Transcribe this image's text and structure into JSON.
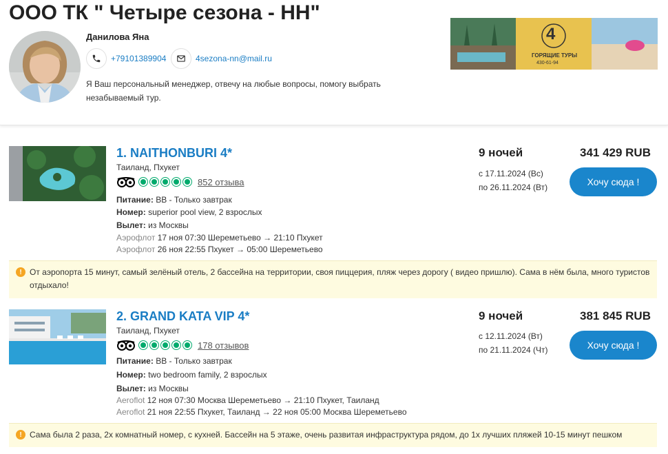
{
  "header": {
    "company": "ООО ТК \" Четыре сезона - НН\"",
    "manager_name": "Данилова Яна",
    "phone": "+79101389904",
    "email": "4sezona-nn@mail.ru",
    "description": "Я Ваш персональный менеджер, отвечу на любые вопросы, помогу выбрать незабываемый тур.",
    "banner": {
      "logo_digit": "4",
      "tagline": "ГОРЯЩИЕ ТУРЫ",
      "phone": "430-61-94"
    }
  },
  "tours": [
    {
      "title": "1. NAITHONBURI 4*",
      "location": "Таиланд, Пхукет",
      "rating_circles": 5,
      "reviews": "852 отзыва",
      "meal_label": "Питание:",
      "meal": "BB - Только завтрак",
      "room_label": "Номер:",
      "room": "superior pool view, 2 взрослых",
      "departure_label": "Вылет:",
      "departure": "из Москвы",
      "flights": [
        {
          "airline": "Аэрофлот",
          "route": "17 ноя 07:30 Шереметьево → 21:10 Пхукет"
        },
        {
          "airline": "Аэрофлот",
          "route": "26 ноя 22:55 Пхукет → 05:00 Шереметьево"
        }
      ],
      "nights": "9 ночей",
      "date_from": "с 17.11.2024 (Вс)",
      "date_to": "по 26.11.2024 (Вт)",
      "price": "341 429 RUB",
      "button": "Хочу сюда !",
      "note": "От аэропорта 15 минут, самый зелёный отель, 2 бассейна на территории, своя пиццерия, пляж через дорогу ( видео пришлю). Сама в нём была, много туристов отдыхало!"
    },
    {
      "title": "2. GRAND KATA VIP 4*",
      "location": "Таиланд, Пхукет",
      "rating_circles": 5,
      "reviews": "178 отзывов",
      "meal_label": "Питание:",
      "meal": "BB - Только завтрак",
      "room_label": "Номер:",
      "room": "two bedroom family, 2 взрослых",
      "departure_label": "Вылет:",
      "departure": "из Москвы",
      "flights": [
        {
          "airline": "Aeroflot",
          "route": "12 ноя 07:30 Москва Шереметьево → 21:10 Пхукет, Таиланд"
        },
        {
          "airline": "Aeroflot",
          "route": "21 ноя 22:55 Пхукет, Таиланд → 22 ноя 05:00 Москва Шереметьево"
        }
      ],
      "nights": "9 ночей",
      "date_from": "с 12.11.2024 (Вт)",
      "date_to": "по 21.11.2024 (Чт)",
      "price": "381 845 RUB",
      "button": "Хочу сюда !",
      "note": "Сама была 2 раза, 2х комнатный номер, с кухней. Бассейн на 5 этаже, очень развитая инфраструктура рядом, до 1х лучших пляжей 10-15 минут пешком"
    }
  ],
  "colors": {
    "accent": "#1a7dc4",
    "button": "#1a86cc",
    "rating": "#00aa6c",
    "note_bg": "#fefbe0",
    "warning": "#f5a623"
  }
}
